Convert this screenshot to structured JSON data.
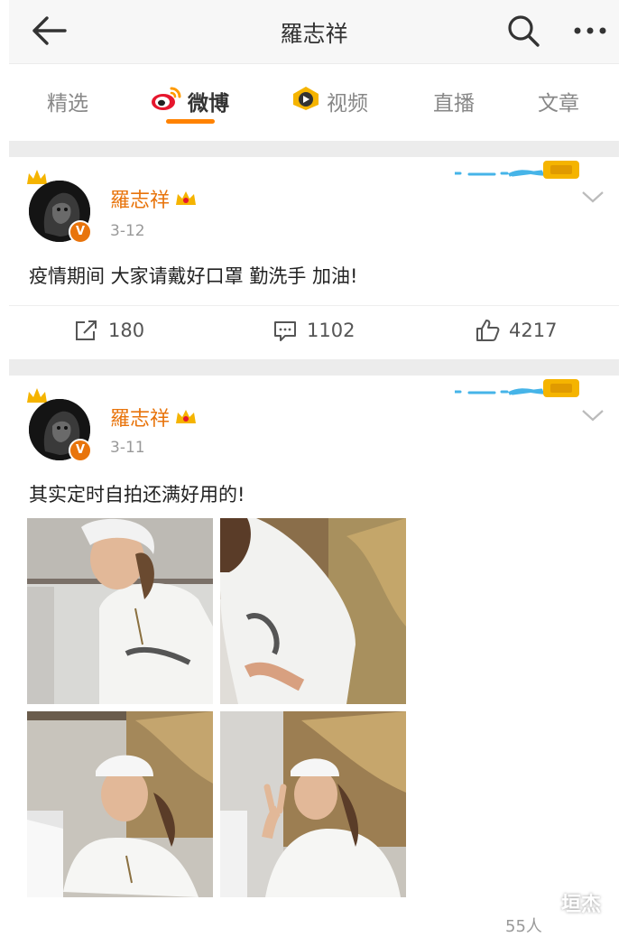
{
  "header": {
    "title": "羅志祥"
  },
  "tabs": [
    {
      "label": "精选"
    },
    {
      "label": "微博"
    },
    {
      "label": "视频"
    },
    {
      "label": "直播"
    },
    {
      "label": "文章"
    }
  ],
  "posts": [
    {
      "author": "羅志祥",
      "time": "3-12",
      "text": "疫情期间 大家请戴好口罩 勤洗手  加油!",
      "reposts": "180",
      "comments": "1102",
      "likes": "4217"
    },
    {
      "author": "羅志祥",
      "time": "3-11",
      "text": "其实定时自拍还满好用的!"
    }
  ],
  "footer": {
    "count": "55人"
  },
  "watermark": "垣杰",
  "colors": {
    "accent": "#ff8200",
    "name": "#e8740c"
  }
}
